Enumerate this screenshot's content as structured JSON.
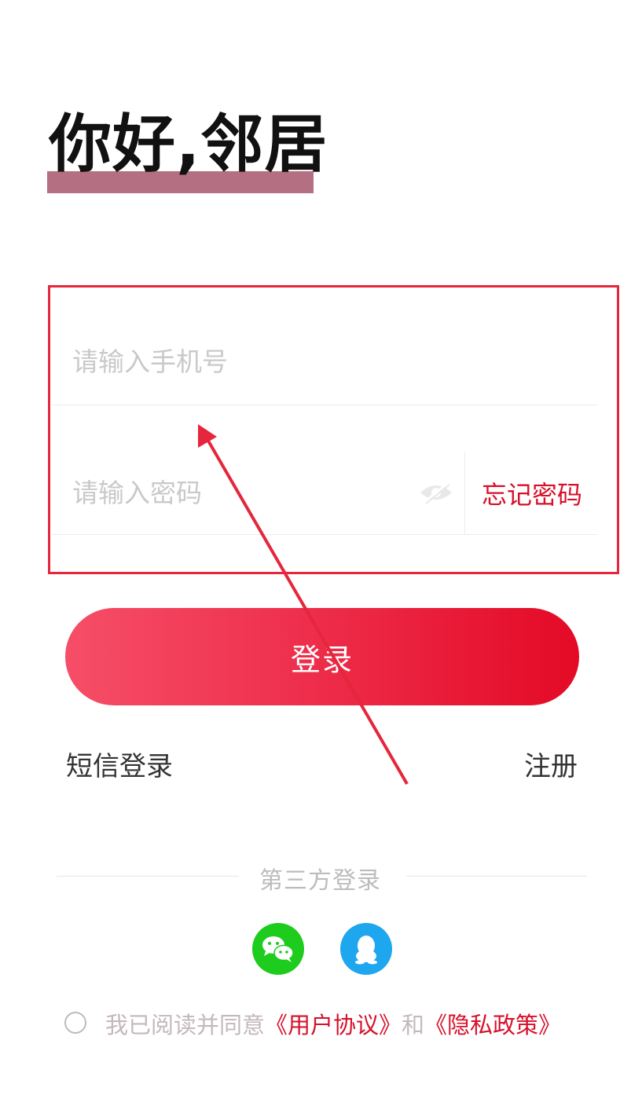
{
  "header": {
    "greeting": "你好,邻居"
  },
  "form": {
    "phone_placeholder": "请输入手机号",
    "password_placeholder": "请输入密码",
    "forgot_label": "忘记密码"
  },
  "actions": {
    "login_label": "登录",
    "sms_login_label": "短信登录",
    "register_label": "注册"
  },
  "third_party": {
    "label": "第三方登录",
    "icons": [
      "wechat-icon",
      "qq-icon"
    ]
  },
  "agreement": {
    "prefix": "我已阅读并同意",
    "user_agreement": "《用户协议》",
    "and": "和",
    "privacy_policy": "《隐私政策》"
  },
  "colors": {
    "accent": "#e40a26",
    "highlight_frame": "#e5263c",
    "greeting_bar": "#a8566c",
    "wechat": "#1ecc1e",
    "qq": "#1ea6ee"
  }
}
